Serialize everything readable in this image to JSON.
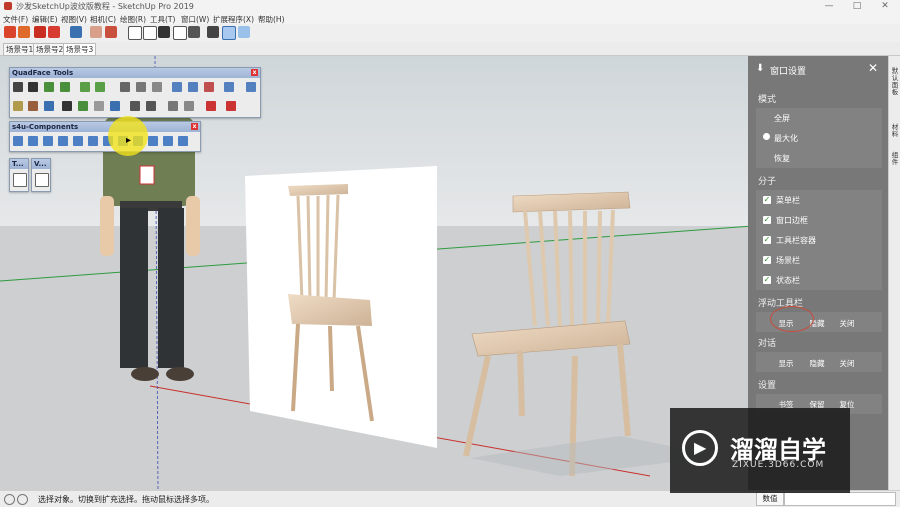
{
  "window": {
    "title": "沙发SketchUp波纹版教程 - SketchUp Pro 2019",
    "minimize": "—",
    "maximize": "□",
    "close": "✕"
  },
  "menu": [
    "文件(F)",
    "编辑(E)",
    "视图(V)",
    "相机(C)",
    "绘图(R)",
    "工具(T)",
    "窗口(W)",
    "扩展程序(X)",
    "帮助(H)"
  ],
  "scenes": [
    "场景号1",
    "场景号2",
    "场景号3"
  ],
  "palettes": {
    "quadface": {
      "title": "QuadFace Tools"
    },
    "s4u": {
      "title": "s4u-Components"
    },
    "small1": {
      "title": "T..."
    },
    "small2": {
      "title": "V..."
    }
  },
  "panel": {
    "title": "窗口设置",
    "sections": {
      "mode": "模式",
      "molecule": "分子",
      "floating": "浮动工具栏",
      "dialog": "对话",
      "settings": "设置"
    },
    "mode_options": [
      "全屏",
      "最大化",
      "恢复"
    ],
    "mode_selected": "最大化",
    "molecule_options": [
      "菜单栏",
      "窗口边框",
      "工具栏容器",
      "场景栏",
      "状态栏"
    ],
    "floating_buttons": [
      "显示",
      "隐藏",
      "关闭"
    ],
    "dialog_buttons": [
      "显示",
      "隐藏",
      "关闭"
    ],
    "settings_buttons": [
      "书签",
      "保留",
      "复位"
    ]
  },
  "right_strip": [
    "默认面板",
    "材料",
    "组件"
  ],
  "status": {
    "text": "选择对象。切换到扩充选择。拖动鼠标选择多项。",
    "measure_label": "数值"
  },
  "watermark": {
    "brand": "溜溜自学",
    "url": "ZIXUE.3D66.COM"
  },
  "colors": {
    "panel_bg": "#787878",
    "check_green": "#2e8b2e",
    "highlight": "#f2e21b"
  }
}
